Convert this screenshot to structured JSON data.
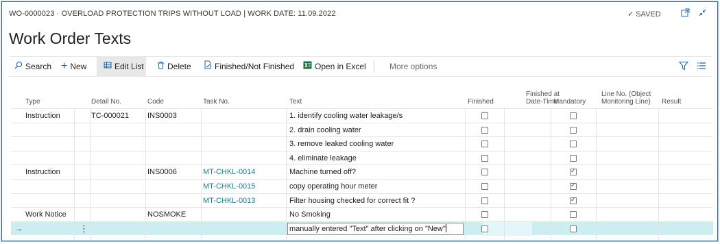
{
  "header": {
    "caption": "WO-0000023 · OVERLOAD PROTECTION TRIPS WITHOUT LOAD | WORK DATE: 11.09.2022",
    "saved_label": "SAVED",
    "title": "Work Order Texts"
  },
  "toolbar": {
    "search_label": "Search",
    "new_label": "New",
    "edit_list_label": "Edit List",
    "delete_label": "Delete",
    "finished_label": "Finished/Not Finished",
    "excel_label": "Open in Excel",
    "more_label": "More options"
  },
  "columns": {
    "type": "Type",
    "detail_no": "Detail No.",
    "code": "Code",
    "task_no": "Task No.",
    "text": "Text",
    "finished": "Finished",
    "finished_at": "Finished at Date-Time",
    "mandatory": "Mandatory",
    "line_no": "Line No. (Object Monitoring Line)",
    "result": "Result"
  },
  "rows": [
    {
      "type": "Instruction",
      "detail_no": "TC-000021",
      "code": "INS0003",
      "task_no": "",
      "text": "1. identify cooling water leakage/s",
      "finished": false,
      "mandatory": false
    },
    {
      "type": "",
      "detail_no": "",
      "code": "",
      "task_no": "",
      "text": "2. drain cooling water",
      "finished": false,
      "mandatory": false
    },
    {
      "type": "",
      "detail_no": "",
      "code": "",
      "task_no": "",
      "text": "3. remove leaked cooling water",
      "finished": false,
      "mandatory": false
    },
    {
      "type": "",
      "detail_no": "",
      "code": "",
      "task_no": "",
      "text": "4. eliminate leakage",
      "finished": false,
      "mandatory": false
    },
    {
      "type": "Instruction",
      "detail_no": "",
      "code": "INS0006",
      "task_no": "MT-CHKL-0014",
      "text": "Machine turned off?",
      "finished": false,
      "mandatory": true
    },
    {
      "type": "",
      "detail_no": "",
      "code": "",
      "task_no": "MT-CHKL-0015",
      "text": "copy operating hour meter",
      "finished": false,
      "mandatory": true
    },
    {
      "type": "",
      "detail_no": "",
      "code": "",
      "task_no": "MT-CHKL-0013",
      "text": "Filter housing checked for correct fit ?",
      "finished": false,
      "mandatory": true
    },
    {
      "type": "Work Notice",
      "detail_no": "",
      "code": "NOSMOKE",
      "task_no": "",
      "text": "No Smoking",
      "finished": false,
      "mandatory": false
    }
  ],
  "new_row": {
    "arrow": "→",
    "dots": "⋮",
    "text_value": "manually entered \"Text\" after clicking on \"New\"",
    "finished": false,
    "mandatory": false
  },
  "colors": {
    "accent": "#1f5f9c",
    "link": "#1f7a8c",
    "selected_row": "#cdeef0"
  }
}
